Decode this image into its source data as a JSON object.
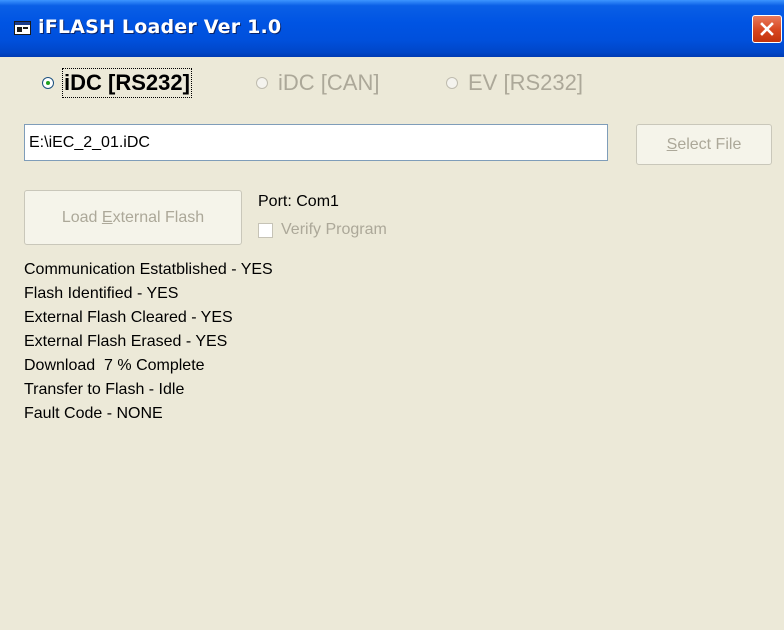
{
  "window": {
    "title": "iFLASH Loader Ver 1.0",
    "app_icon": "app-window-icon",
    "close_icon": "close-icon"
  },
  "protocol": {
    "options": [
      {
        "label": "iDC [RS232]",
        "checked": true,
        "enabled": true
      },
      {
        "label": "iDC [CAN]",
        "checked": false,
        "enabled": false
      },
      {
        "label": "EV [RS232]",
        "checked": false,
        "enabled": false
      }
    ]
  },
  "file": {
    "path_value": "E:\\iEC_2_01.iDC",
    "select_button": {
      "pre": "",
      "mnemonic": "S",
      "post": "elect File",
      "enabled": false
    }
  },
  "load": {
    "button": {
      "pre": "Load ",
      "mnemonic": "E",
      "post": "xternal Flash",
      "enabled": false
    },
    "port_label": "Port: Com1",
    "verify_label": "Verify Program",
    "verify_checked": false
  },
  "status_lines": [
    "Communication Estatblished - YES",
    "Flash Identified - YES",
    "External Flash Cleared - YES",
    "External Flash Erased - YES",
    "Download  7 % Complete",
    "Transfer to Flash - Idle",
    "Fault Code - NONE"
  ],
  "colors": {
    "titlebar": "#0054e3",
    "window_bg": "#ece9d8",
    "disabled_text": "#aca899",
    "close_button": "#d7461f"
  }
}
